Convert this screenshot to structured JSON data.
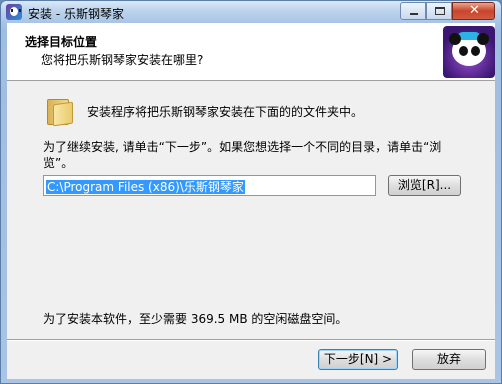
{
  "window": {
    "title": "安装 - 乐斯钢琴家",
    "icon": "app-panda-icon",
    "min_icon": "minimize-icon",
    "max_icon": "maximize-icon",
    "close_icon": "close-icon"
  },
  "header": {
    "title": "选择目标位置",
    "subtitle": "您将把乐斯钢琴家安装在哪里?",
    "logo": "panda-logo"
  },
  "body": {
    "folder_icon": "folder-icon",
    "intro": "安装程序将把乐斯钢琴家安装在下面的的文件夹中。",
    "continue_note": "为了继续安装, 请单击“下一步”。如果您想选择一个不同的目录，请单击“浏览”。",
    "path_value": "C:\\Program Files (x86)\\乐斯钢琴家",
    "browse_label": "浏览[R]...",
    "space_note": "为了安装本软件，至少需要 369.5 MB 的空闲磁盘空间。"
  },
  "footer": {
    "next_label": "下一步[N] >",
    "cancel_label": "放弃"
  }
}
